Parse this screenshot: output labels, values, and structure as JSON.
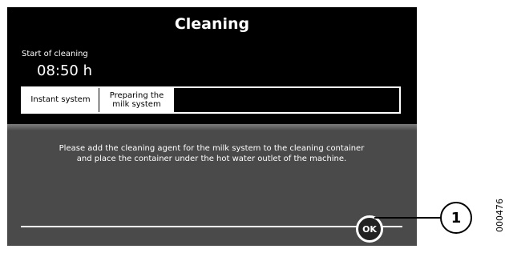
{
  "screen": {
    "title": "Cleaning",
    "start_label": "Start of cleaning",
    "start_time": "08:50 h",
    "steps": [
      {
        "label": "Instant system"
      },
      {
        "label": "Preparing the\nmilk system"
      }
    ],
    "message": "Please add the cleaning agent for the milk system to the cleaning container and place the container under the hot water outlet of the machine.",
    "ok_label": "OK"
  },
  "annotation": {
    "callout": "1",
    "figure_id": "000476"
  },
  "colors": {
    "screen_bg": "#000000",
    "panel_bg": "#4a4a4a",
    "text": "#ffffff"
  }
}
